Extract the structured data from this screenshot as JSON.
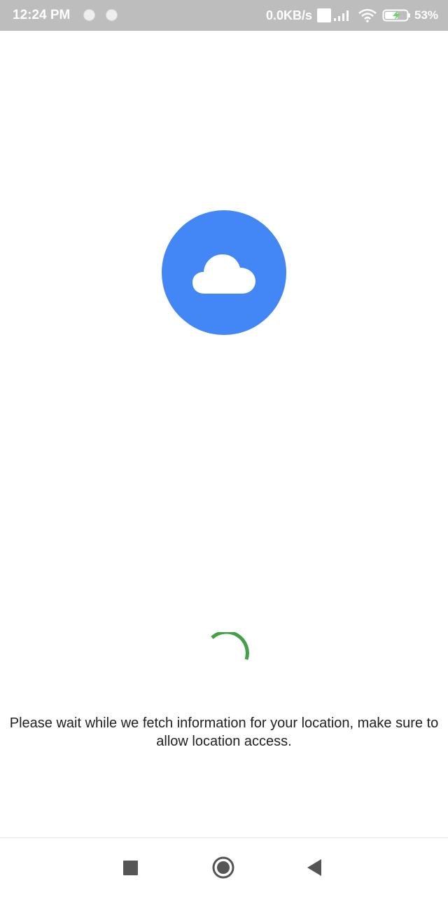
{
  "status_bar": {
    "time": "12:24 PM",
    "network_speed": "0.0KB/s",
    "battery_percent": "53%",
    "icons": [
      "notification-dot-icon",
      "notification-dot-icon",
      "volte-icon",
      "signal-icon",
      "wifi-icon",
      "battery-charging-icon"
    ]
  },
  "main": {
    "logo_icon": "cloud-icon",
    "logo_color": "#4287f5",
    "spinner_color": "#43a047",
    "message": "Please wait while we fetch information for your location, make sure to allow location access."
  },
  "nav_bar": {
    "buttons": [
      "recents-button",
      "home-button",
      "back-button"
    ]
  }
}
